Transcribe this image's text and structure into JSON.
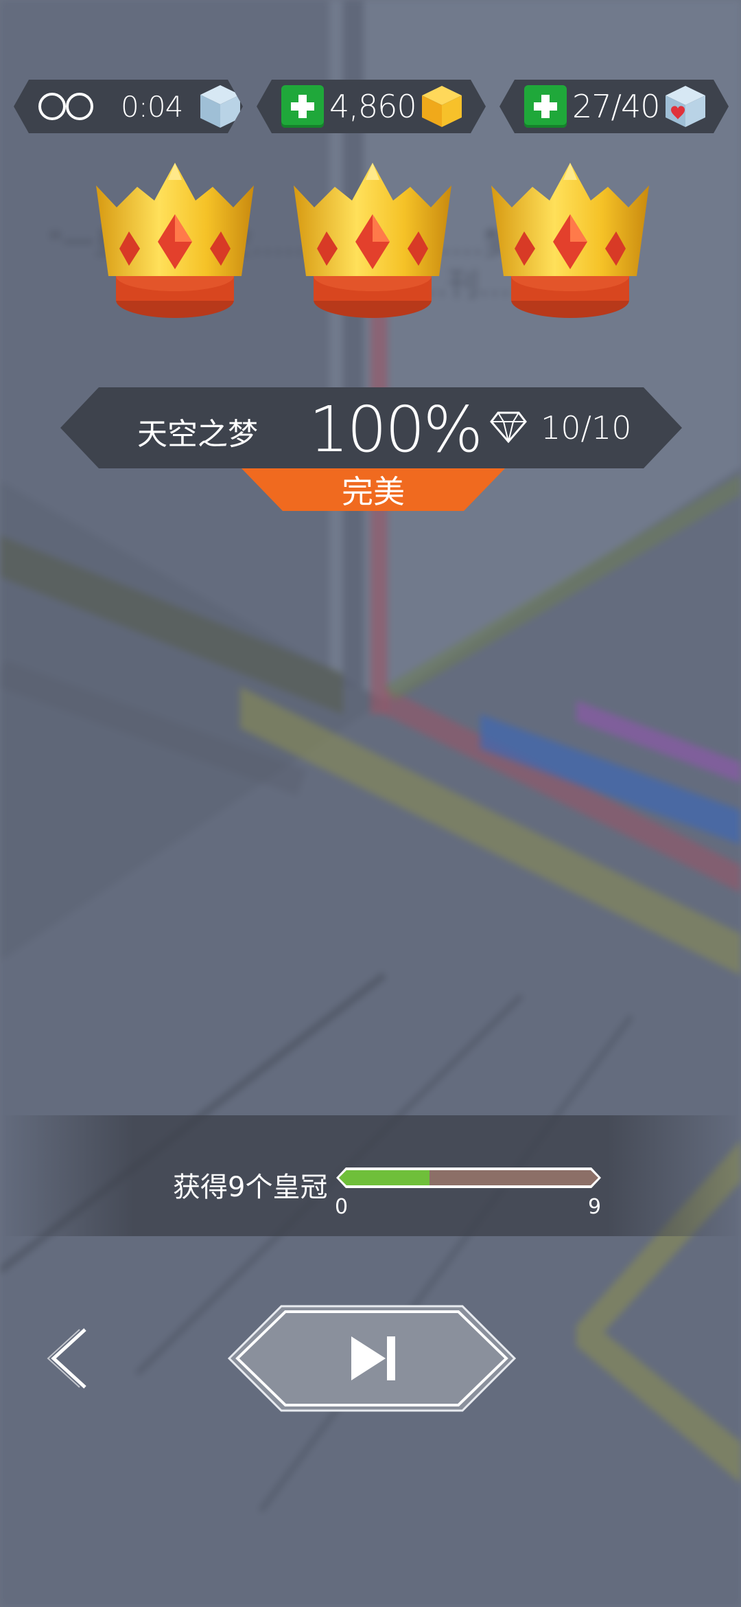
{
  "hud": {
    "timer": "0:04",
    "coins": "4,860",
    "hearts": "27/40",
    "icons": [
      "infinity-icon",
      "ice-cube-icon",
      "gold-cube-icon",
      "heart-cube-icon",
      "plus-icon"
    ]
  },
  "result": {
    "crowns_earned": 3,
    "level_name": "天空之梦",
    "percent": "100%",
    "gems": "10/10",
    "rating": "完美"
  },
  "crown_progress": {
    "label": "获得9个皇冠",
    "min": "0",
    "max": "9",
    "fill_fraction": 0.35
  },
  "colors": {
    "accent": "#f06a1f",
    "green": "#1fa83a",
    "progress_green": "#6fbf3a",
    "gold": "#f2c21e"
  }
}
